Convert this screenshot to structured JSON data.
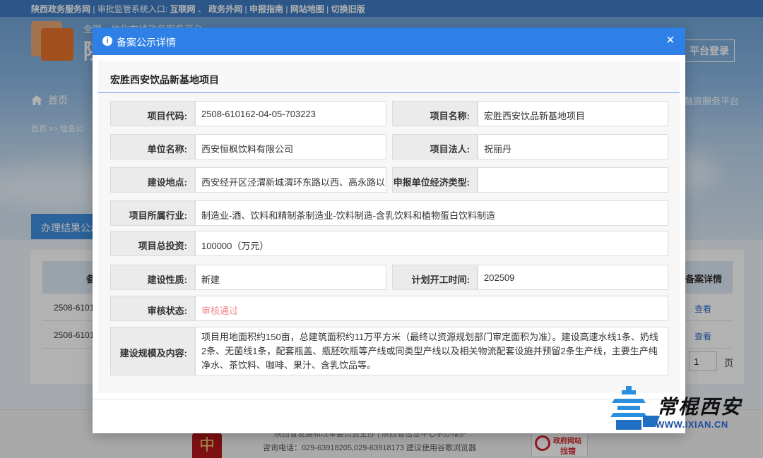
{
  "background": {
    "topbar": {
      "site": "陕西政务服务网",
      "entry_label": "审批监管系统入口:",
      "links": [
        "互联网",
        "政务外网",
        "申报指南",
        "网站地图",
        "切换旧版"
      ]
    },
    "subtitle": "全国一体化在线政务服务平台",
    "title_char": "陕",
    "login_label": "平台登录",
    "nav_home": "首页",
    "nav_right": "融资服务平台",
    "breadcrumb": "首页  >>  信息公",
    "result_tab": "办理结果公示",
    "table": {
      "head_left": "备",
      "head_right": "备案详情",
      "rows": [
        {
          "code": "2508-6101",
          "link": "查看"
        },
        {
          "code": "2508-6101",
          "link": "查看"
        }
      ]
    },
    "pager": {
      "page": "1",
      "unit": "页"
    },
    "footer": {
      "line1": "陕西省发展和改革委员会主办 | 陕西省信息中心承办维护",
      "line2": "咨询电话：029-63918205,029-63918173 建议使用谷歌浏览器",
      "emblem": "中",
      "badge_title": "政府网站",
      "badge_action": "找错"
    }
  },
  "modal": {
    "title": "备案公示详情",
    "close": "×",
    "project_title": "宏胜西安饮品新基地项目",
    "fields": {
      "code_label": "项目代码:",
      "code_value": "2508-610162-04-05-703223",
      "name_label": "项目名称:",
      "name_value": "宏胜西安饮品新基地项目",
      "unit_label": "单位名称:",
      "unit_value": "西安恒枫饮料有限公司",
      "legal_label": "项目法人:",
      "legal_value": "祝丽丹",
      "site_label": "建设地点:",
      "site_value": "西安经开区泾渭新城渭环东路以西、高永路以南",
      "econ_label": "申报单位经济类型:",
      "econ_value": "",
      "industry_label": "项目所属行业:",
      "industry_value": "制造业-酒、饮料和精制茶制造业-饮料制造-含乳饮料和植物蛋白饮料制造",
      "invest_label": "项目总投资:",
      "invest_value": "100000（万元）",
      "nature_label": "建设性质:",
      "nature_value": "新建",
      "start_label": "计划开工时间:",
      "start_value": "202509",
      "status_label": "审核状态:",
      "status_value": "审核通过",
      "scope_label": "建设规模及内容:",
      "scope_value": "项目用地面积约150亩，总建筑面积约11万平方米（最终以资源规划部门审定面积为准）。建设高速水线1条、奶线2条、无菌线1条，配套瓶盖、瓶胚吹瓶等产线或同类型产线以及相关物流配套设施并预留2条生产线，主要生产纯净水、茶饮料、咖啡、果汁、含乳饮品等。"
    }
  },
  "watermark": {
    "brand": "常棍西安",
    "url": "WWW.IXIAN.CN"
  },
  "colors": {
    "accent": "#2f80e6",
    "status_pass": "#f0888a",
    "label_bg": "#ebebeb"
  }
}
